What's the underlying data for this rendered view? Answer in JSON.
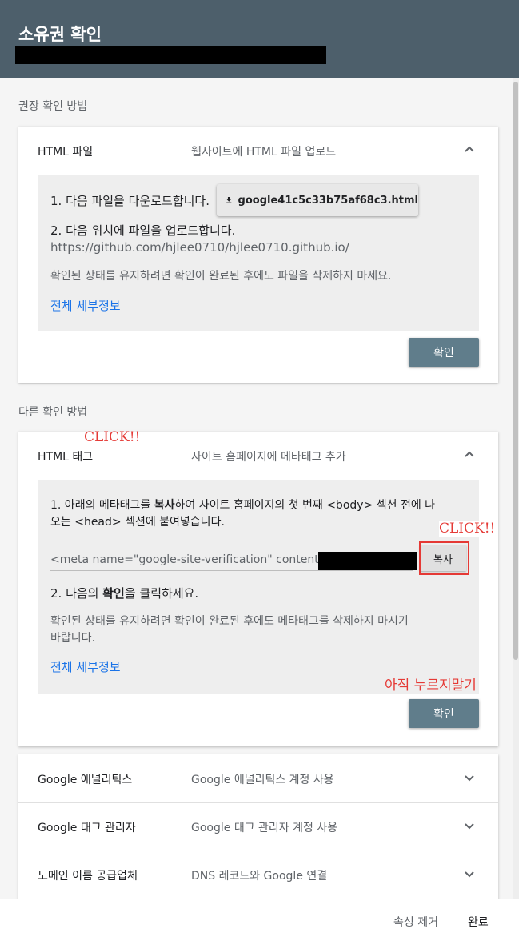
{
  "header": {
    "title": "소유권 확인"
  },
  "recommended": {
    "label": "권장 확인 방법",
    "card": {
      "title": "HTML 파일",
      "subtitle": "웹사이트에 HTML 파일 업로드",
      "step1": "1. 다음 파일을 다운로드합니다.",
      "download_file": "google41c5c33b75af68c3.html",
      "step2": "2. 다음 위치에 파일을 업로드합니다.",
      "upload_url": "https://github.com/hjlee0710/hjlee0710.github.io/",
      "note": "확인된 상태를 유지하려면 확인이 완료된 후에도 파일을 삭제하지 마세요.",
      "details_link": "전체 세부정보",
      "confirm": "확인"
    }
  },
  "other": {
    "label": "다른 확인 방법",
    "meta_card": {
      "title": "HTML 태그",
      "subtitle": "사이트 홈페이지에 메타태그 추가",
      "step1_a": "1. 아래의 메타태그를 ",
      "step1_b": "복사",
      "step1_c": "하여 사이트 홈페이지의 첫 번째 <body> 섹션 전에 나",
      "step1_d": "오는 <head> 섹션에 붙여넣습니다.",
      "meta_value": "<meta name=\"google-site-verification\" content=",
      "copy": "복사",
      "step2_a": "2. 다음의 ",
      "step2_b": "확인",
      "step2_c": "을 클릭하세요.",
      "note_line1": "확인된 상태를 유지하려면 확인이 완료된 후에도 메타태그를 삭제하지 마시기",
      "note_line2": "바랍니다.",
      "details_link": "전체 세부정보",
      "confirm": "확인"
    },
    "rows": [
      {
        "title": "Google 애널리틱스",
        "subtitle": "Google 애널리틱스 계정 사용"
      },
      {
        "title": "Google 태그 관리자",
        "subtitle": "Google 태그 관리자 계정 사용"
      },
      {
        "title": "도메인 이름 공급업체",
        "subtitle": "DNS 레코드와 Google 연결"
      }
    ]
  },
  "annotations": {
    "click_tag": "CLICK!!",
    "click_copy": "CLICK!!",
    "dont_press": "아직 누르지말기"
  },
  "footer": {
    "remove": "속성 제거",
    "done": "완료"
  },
  "colors": {
    "header_bg": "#4d5f6b",
    "confirm_bg": "#607d8b",
    "link": "#1a73e8",
    "annotation": "#e53935"
  }
}
